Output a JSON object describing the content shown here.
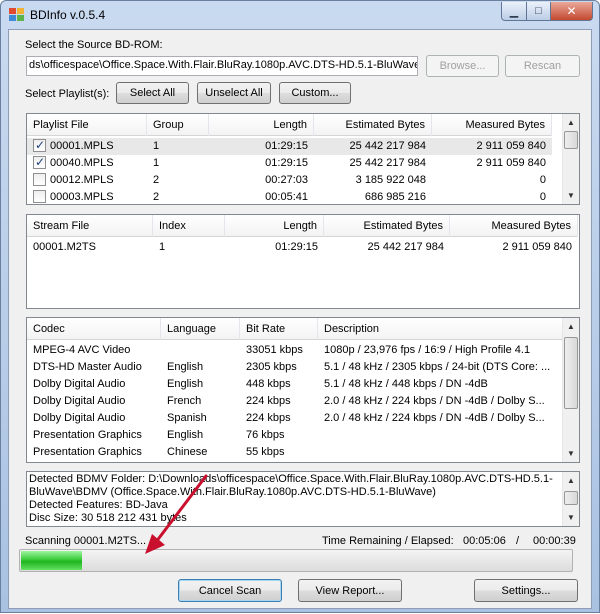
{
  "window": {
    "title": "BDInfo v.0.5.4"
  },
  "source": {
    "label": "Select the Source BD-ROM:",
    "path": "ds\\officespace\\Office.Space.With.Flair.BluRay.1080p.AVC.DTS-HD.5.1-BluWave",
    "browse_label": "Browse...",
    "rescan_label": "Rescan"
  },
  "playlists": {
    "label": "Select Playlist(s):",
    "select_all_label": "Select All",
    "unselect_all_label": "Unselect All",
    "custom_label": "Custom...",
    "columns": [
      "Playlist File",
      "Group",
      "Length",
      "Estimated Bytes",
      "Measured Bytes"
    ],
    "rows": [
      {
        "checked": true,
        "file": "00001.MPLS",
        "group": "1",
        "length": "01:29:15",
        "estimated": "25 442 217 984",
        "measured": "2 911 059 840"
      },
      {
        "checked": true,
        "file": "00040.MPLS",
        "group": "1",
        "length": "01:29:15",
        "estimated": "25 442 217 984",
        "measured": "2 911 059 840"
      },
      {
        "checked": false,
        "file": "00012.MPLS",
        "group": "2",
        "length": "00:27:03",
        "estimated": "3 185 922 048",
        "measured": "0"
      },
      {
        "checked": false,
        "file": "00003.MPLS",
        "group": "2",
        "length": "00:05:41",
        "estimated": "686 985 216",
        "measured": "0"
      }
    ]
  },
  "streams": {
    "columns": [
      "Stream File",
      "Index",
      "Length",
      "Estimated Bytes",
      "Measured Bytes"
    ],
    "rows": [
      {
        "file": "00001.M2TS",
        "index": "1",
        "length": "01:29:15",
        "estimated": "25 442 217 984",
        "measured": "2 911 059 840"
      }
    ]
  },
  "codecs": {
    "columns": [
      "Codec",
      "Language",
      "Bit Rate",
      "Description"
    ],
    "rows": [
      {
        "codec": "MPEG-4 AVC Video",
        "language": "",
        "bitrate": "33051 kbps",
        "description": "1080p / 23,976 fps / 16:9 / High Profile 4.1"
      },
      {
        "codec": "DTS-HD Master Audio",
        "language": "English",
        "bitrate": "2305 kbps",
        "description": "5.1 / 48 kHz / 2305 kbps / 24-bit (DTS Core: ..."
      },
      {
        "codec": "Dolby Digital Audio",
        "language": "English",
        "bitrate": "448 kbps",
        "description": "5.1 / 48 kHz / 448 kbps / DN -4dB"
      },
      {
        "codec": "Dolby Digital Audio",
        "language": "French",
        "bitrate": "224 kbps",
        "description": "2.0 / 48 kHz / 224 kbps / DN -4dB / Dolby S..."
      },
      {
        "codec": "Dolby Digital Audio",
        "language": "Spanish",
        "bitrate": "224 kbps",
        "description": "2.0 / 48 kHz / 224 kbps / DN -4dB / Dolby S..."
      },
      {
        "codec": "Presentation Graphics",
        "language": "English",
        "bitrate": "76 kbps",
        "description": ""
      },
      {
        "codec": "Presentation Graphics",
        "language": "Chinese",
        "bitrate": "55 kbps",
        "description": ""
      }
    ]
  },
  "info": {
    "lines": [
      "Detected BDMV Folder: D:\\Downloads\\officespace\\Office.Space.With.Flair.BluRay.1080p.AVC.DTS-HD.5.1-",
      "BluWave\\BDMV (Office.Space.With.Flair.BluRay.1080p.AVC.DTS-HD.5.1-BluWave)",
      "Detected Features: BD-Java",
      "Disc Size: 30 518 212 431 bytes"
    ]
  },
  "status": {
    "scanning": "Scanning 00001.M2TS...",
    "time_label": "Time Remaining / Elapsed:",
    "remaining": "00:05:06",
    "separator": "/",
    "elapsed": "00:00:39",
    "progress_percent": 11
  },
  "footer": {
    "cancel_label": "Cancel Scan",
    "report_label": "View Report...",
    "settings_label": "Settings..."
  },
  "colors": {
    "arrow": "#c8102e",
    "progress": "#2cc22c"
  }
}
